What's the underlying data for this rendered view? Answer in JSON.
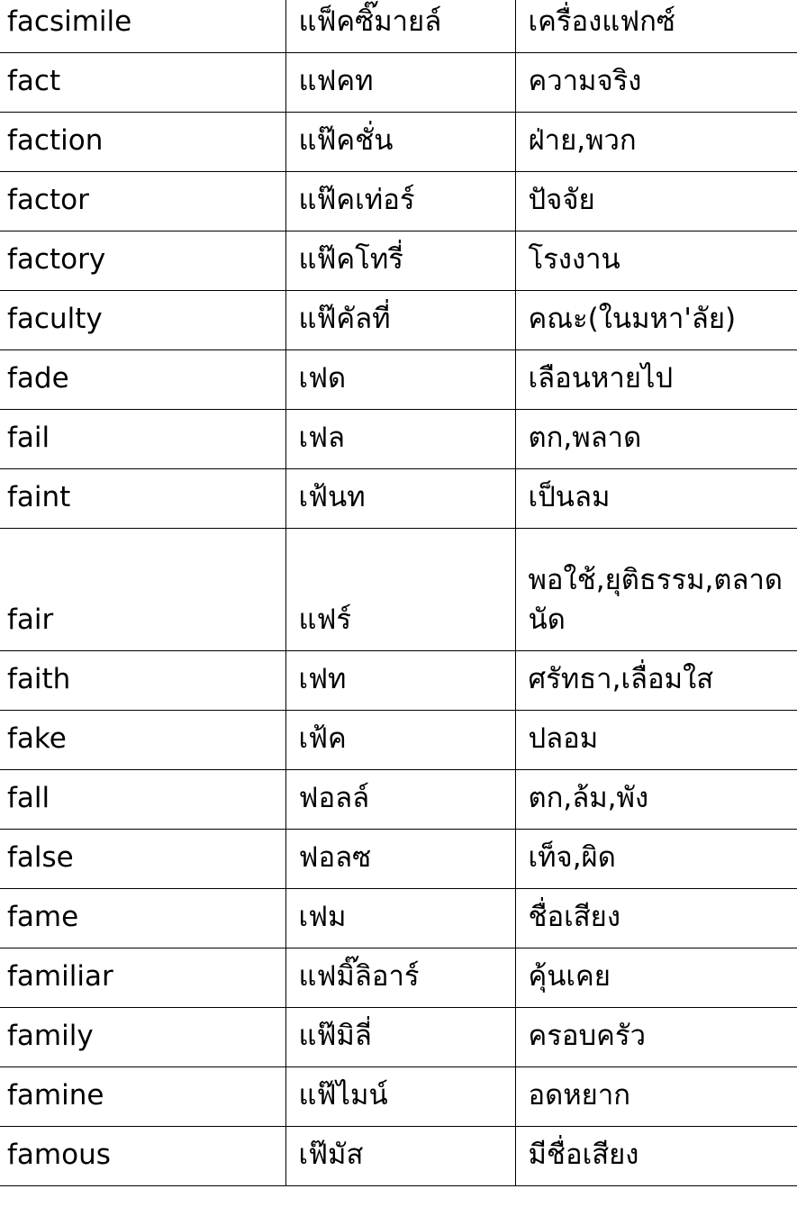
{
  "rows": [
    {
      "word": "facsimile",
      "pron": "แฟ็คซิ๊มายล์",
      "meaning": "เครื่องแฟกซ์"
    },
    {
      "word": "fact",
      "pron": "แฟคท",
      "meaning": "ความจริง"
    },
    {
      "word": "faction",
      "pron": "แฟ๊คชั่น",
      "meaning": "ฝ่าย,พวก"
    },
    {
      "word": "factor",
      "pron": "แฟ๊คเท่อร์",
      "meaning": "ปัจจัย"
    },
    {
      "word": "factory",
      "pron": "แฟ๊คโทรี่",
      "meaning": "โรงงาน"
    },
    {
      "word": "faculty",
      "pron": "แฟ๊คัลที่",
      "meaning": "คณะ(ในมหา'ลัย)"
    },
    {
      "word": "fade",
      "pron": "เฟด",
      "meaning": "เลือนหายไป"
    },
    {
      "word": "fail",
      "pron": "เฟล",
      "meaning": "ตก,พลาด"
    },
    {
      "word": "faint",
      "pron": "เฟ้นท",
      "meaning": "เป็นลม"
    },
    {
      "word": "fair",
      "pron": "แฟร์",
      "meaning_line1": "พอใช้,ยุติธรรม,ตลาด",
      "meaning_line2": "นัด"
    },
    {
      "word": "faith",
      "pron": "เฟท",
      "meaning": "ศรัทธา,เลื่อมใส"
    },
    {
      "word": "fake",
      "pron": "เฟ้ค",
      "meaning": "ปลอม"
    },
    {
      "word": "fall",
      "pron": "ฟอลล์",
      "meaning": "ตก,ล้ม,พัง"
    },
    {
      "word": "false",
      "pron": "ฟอลซ",
      "meaning": "เท็จ,ผิด"
    },
    {
      "word": "fame",
      "pron": "เฟม",
      "meaning": "ชื่อเสียง"
    },
    {
      "word": "familiar",
      "pron": "แฟมิ๊ลิอาร์",
      "meaning": "คุ้นเคย"
    },
    {
      "word": "family",
      "pron": "แฟ๊มิลี่",
      "meaning": "ครอบครัว"
    },
    {
      "word": "famine",
      "pron": "แฟ๊ไมน์",
      "meaning": "อดหยาก"
    },
    {
      "word": "famous",
      "pron": "เฟ๊มัส",
      "meaning": "มีชื่อเสียง"
    }
  ]
}
